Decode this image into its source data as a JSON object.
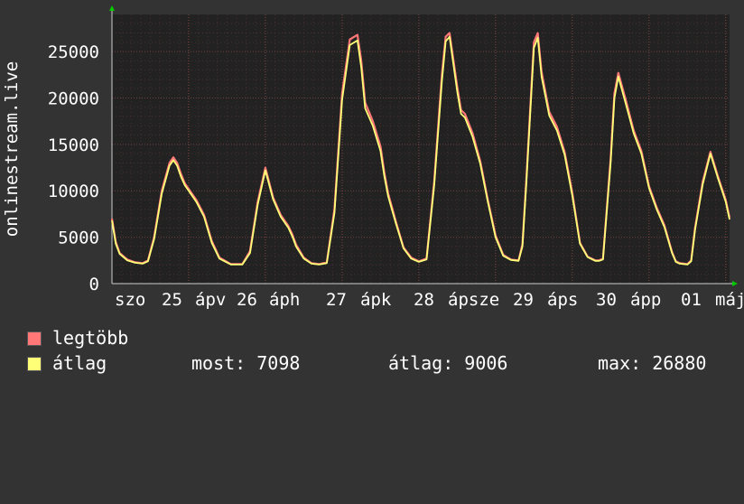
{
  "chart_data": {
    "type": "line",
    "ylabel": "onlinestream.live",
    "ylim": [
      0,
      29000
    ],
    "yticks": [
      0,
      5000,
      10000,
      15000,
      20000,
      25000
    ],
    "xticks": [
      "szo",
      "25 ápr",
      "26 ápr",
      "27 ápr",
      "28 ápr",
      "29 ápr",
      "30 ápr",
      "01 máj"
    ],
    "xtick_label_fragments": [
      "szo",
      "25",
      "ápv",
      "26",
      "áph",
      "27",
      "ápk",
      "28",
      "ápsze",
      "29",
      "áps",
      "30",
      "ápp",
      "01",
      "máj"
    ],
    "grid": true,
    "x_range_days": [
      0,
      8.05
    ],
    "series": [
      {
        "name": "legtöbb",
        "color": "#ff7777",
        "x": [
          0,
          0.05,
          0.1,
          0.2,
          0.3,
          0.4,
          0.47,
          0.55,
          0.65,
          0.75,
          0.8,
          0.85,
          0.9,
          0.95,
          1,
          1.1,
          1.2,
          1.3,
          1.4,
          1.55,
          1.7,
          1.8,
          1.9,
          2,
          2.1,
          2.2,
          2.3,
          2.35,
          2.4,
          2.5,
          2.6,
          2.7,
          2.8,
          2.9,
          3,
          3.1,
          3.2,
          3.25,
          3.3,
          3.4,
          3.5,
          3.55,
          3.6,
          3.7,
          3.8,
          3.9,
          4,
          4.1,
          4.2,
          4.3,
          4.35,
          4.4,
          4.5,
          4.55,
          4.6,
          4.7,
          4.8,
          4.9,
          5,
          5.1,
          5.2,
          5.3,
          5.35,
          5.4,
          5.5,
          5.55,
          5.6,
          5.7,
          5.8,
          5.9,
          6,
          6.1,
          6.2,
          6.3,
          6.35,
          6.4,
          6.5,
          6.55,
          6.6,
          6.7,
          6.8,
          6.9,
          7,
          7.1,
          7.2,
          7.3,
          7.35,
          7.4,
          7.5,
          7.55,
          7.6,
          7.7,
          7.8,
          7.9,
          8,
          8.05
        ],
        "values": [
          7000,
          4500,
          3300,
          2600,
          2300,
          2200,
          2500,
          5000,
          10000,
          13000,
          13600,
          13000,
          11800,
          10800,
          10200,
          9000,
          7400,
          4600,
          2800,
          2100,
          2100,
          3500,
          8800,
          12500,
          9300,
          7400,
          6200,
          5300,
          4200,
          2800,
          2200,
          2100,
          2300,
          8000,
          20500,
          26300,
          26800,
          24000,
          19500,
          17500,
          14800,
          12000,
          9700,
          6700,
          3900,
          2800,
          2400,
          2700,
          11000,
          22500,
          26600,
          27000,
          21200,
          18700,
          18300,
          16200,
          13200,
          9000,
          5200,
          3100,
          2600,
          2500,
          4200,
          11000,
          26000,
          27000,
          22800,
          18500,
          16900,
          14200,
          9800,
          4400,
          2900,
          2500,
          2500,
          2700,
          13500,
          20500,
          22700,
          19700,
          16500,
          14300,
          10500,
          8200,
          6300,
          3400,
          2400,
          2200,
          2100,
          2500,
          6000,
          11000,
          14200,
          11500,
          9000,
          7100
        ]
      },
      {
        "name": "átlag",
        "color": "#ffff77",
        "x": [
          0,
          0.05,
          0.1,
          0.2,
          0.3,
          0.4,
          0.47,
          0.55,
          0.65,
          0.75,
          0.8,
          0.85,
          0.9,
          0.95,
          1,
          1.1,
          1.2,
          1.3,
          1.4,
          1.55,
          1.7,
          1.8,
          1.9,
          2,
          2.1,
          2.2,
          2.3,
          2.35,
          2.4,
          2.5,
          2.6,
          2.7,
          2.8,
          2.9,
          3,
          3.1,
          3.2,
          3.25,
          3.3,
          3.4,
          3.5,
          3.55,
          3.6,
          3.7,
          3.8,
          3.9,
          4,
          4.1,
          4.2,
          4.3,
          4.35,
          4.4,
          4.5,
          4.55,
          4.6,
          4.7,
          4.8,
          4.9,
          5,
          5.1,
          5.2,
          5.3,
          5.35,
          5.4,
          5.5,
          5.55,
          5.6,
          5.7,
          5.8,
          5.9,
          6,
          6.1,
          6.2,
          6.3,
          6.35,
          6.4,
          6.5,
          6.55,
          6.6,
          6.7,
          6.8,
          6.9,
          7,
          7.1,
          7.2,
          7.3,
          7.35,
          7.4,
          7.5,
          7.55,
          7.6,
          7.7,
          7.8,
          7.9,
          8,
          8.05
        ],
        "values": [
          6800,
          4300,
          3200,
          2500,
          2250,
          2150,
          2400,
          4800,
          9700,
          12700,
          13300,
          12700,
          11500,
          10600,
          10000,
          8800,
          7200,
          4400,
          2700,
          2050,
          2050,
          3300,
          8500,
          12200,
          9100,
          7200,
          6000,
          5100,
          4000,
          2700,
          2150,
          2050,
          2200,
          7600,
          19800,
          25700,
          26200,
          23300,
          18900,
          17000,
          14300,
          11600,
          9400,
          6500,
          3800,
          2700,
          2350,
          2600,
          10600,
          21800,
          26100,
          26600,
          20700,
          18300,
          17900,
          15800,
          12900,
          8800,
          5000,
          3000,
          2550,
          2450,
          4000,
          10600,
          25400,
          26500,
          22300,
          18100,
          16500,
          13900,
          9500,
          4300,
          2850,
          2450,
          2450,
          2600,
          13000,
          20000,
          22300,
          19300,
          16200,
          14000,
          10300,
          8000,
          6100,
          3300,
          2350,
          2150,
          2050,
          2400,
          5800,
          10700,
          14000,
          11300,
          8800,
          6900
        ]
      }
    ]
  },
  "legend": {
    "items": [
      {
        "label": "legtöbb",
        "color": "#ff7777"
      },
      {
        "label": "átlag",
        "color": "#ffff77"
      }
    ],
    "stats": {
      "now": "most: 7098",
      "avg": "átlag: 9006",
      "max": "max: 26880"
    }
  },
  "colors": {
    "background": "#333333",
    "plot_background": "#222222",
    "grid": "#6a3a3a",
    "axis_arrow": "#00cc00",
    "text": "#ffffff"
  }
}
